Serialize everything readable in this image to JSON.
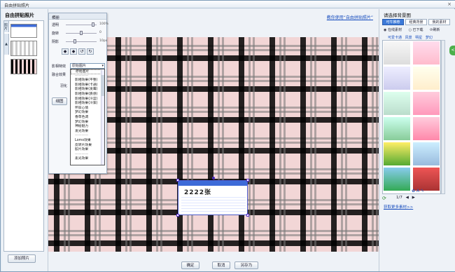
{
  "window": {
    "title": "自由拼贴照片",
    "close_label": "×"
  },
  "left": {
    "panel_title": "自由拼贴照片",
    "vtab_photos": "照片",
    "vtab_other": "▲",
    "add_photo_label": "添加照片"
  },
  "center": {
    "tutorial_link": "教你使用“自由拼贴照片”",
    "confirm_label": "确定",
    "cancel_label": "取消",
    "save_as_label": "另存为"
  },
  "props": {
    "header": "相册",
    "rows": [
      {
        "label": "透明",
        "value": "100%",
        "knob": 0.85
      },
      {
        "label": "旋转",
        "value": "0",
        "knob": 0.5
      },
      {
        "label": "阴影",
        "value": "10px",
        "knob": 0.3
      }
    ],
    "effect_label": "影相特效",
    "effect_value": "原始图片",
    "blend_label": "融合效果",
    "other_label": "羽化",
    "btn_label": "细图"
  },
  "dropdown_items": [
    {
      "text": "原始图片",
      "type": "sel"
    },
    {
      "text": "————",
      "type": "dis"
    },
    {
      "text": "影相效果(平整)",
      "type": "n"
    },
    {
      "text": "影相效果(卡通)",
      "type": "n"
    },
    {
      "text": "影相效果(发霉)",
      "type": "n"
    },
    {
      "text": "影相效果(质感)",
      "type": "n"
    },
    {
      "text": "影相效果(冷蓝)",
      "type": "n"
    },
    {
      "text": "影相效果(冷紫)",
      "type": "n"
    },
    {
      "text": "怀旧心情",
      "type": "n"
    },
    {
      "text": "梦幻效果",
      "type": "n"
    },
    {
      "text": "香草色调",
      "type": "n"
    },
    {
      "text": "梦幻效果",
      "type": "n"
    },
    {
      "text": "神秘魅力",
      "type": "n"
    },
    {
      "text": "发光效果",
      "type": "n"
    },
    {
      "text": "————",
      "type": "dis"
    },
    {
      "text": "Lomo效果",
      "type": "n"
    },
    {
      "text": "反转片效果",
      "type": "n"
    },
    {
      "text": "胶片效果",
      "type": "n"
    },
    {
      "text": "————",
      "type": "dis"
    },
    {
      "text": "柔光效果",
      "type": "n"
    }
  ],
  "right": {
    "title": "请选择背景图",
    "tabs": [
      "可牛推荐",
      "经典背景",
      "我的素材"
    ],
    "radios": [
      "在线素材",
      "已下载"
    ],
    "refresh_label": "刷新",
    "subtabs": [
      "可爱卡通",
      "风景",
      "明星",
      "梦幻"
    ],
    "page_label": "1/7",
    "more_link": "获取更多素材>>",
    "side_flag": "<"
  },
  "photo": {
    "logo_text": "2222张"
  },
  "colors": {
    "accent": "#3d7ad8",
    "link": "#1a4fbf",
    "selection": "#5a2fd0"
  }
}
